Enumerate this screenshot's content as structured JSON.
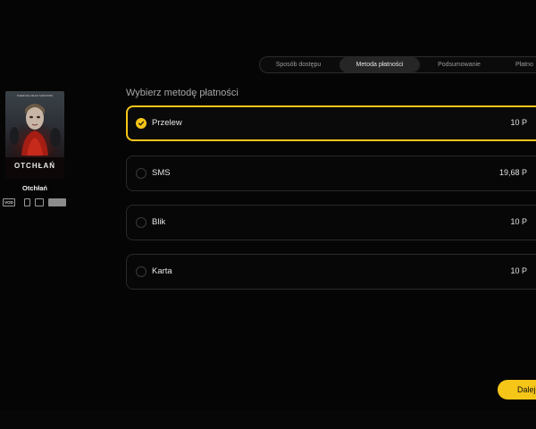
{
  "stepper": {
    "steps": [
      {
        "label": "Sposób dostępu"
      },
      {
        "label": "Metoda płatności"
      },
      {
        "label": "Podsumowanie"
      },
      {
        "label": "Płatno"
      }
    ],
    "active_index": 1
  },
  "movie": {
    "poster_title": "OTCHŁAŃ",
    "poster_tagline": "THERE WILL BE NO SURVIVORS",
    "title": "Otchłań",
    "badges": {
      "vod": "VOD",
      "phone": "phone-icon",
      "tablet": "tablet-icon",
      "tv": "tv-icon"
    }
  },
  "payment": {
    "heading": "Wybierz metodę płatności",
    "options": [
      {
        "label": "Przelew",
        "price": "10 P",
        "selected": true
      },
      {
        "label": "SMS",
        "price": "19,68 P",
        "selected": false
      },
      {
        "label": "Blik",
        "price": "10 P",
        "selected": false
      },
      {
        "label": "Karta",
        "price": "10 P",
        "selected": false
      }
    ]
  },
  "actions": {
    "next_label": "Dalej"
  },
  "colors": {
    "accent": "#f5c518",
    "background": "#050505"
  }
}
